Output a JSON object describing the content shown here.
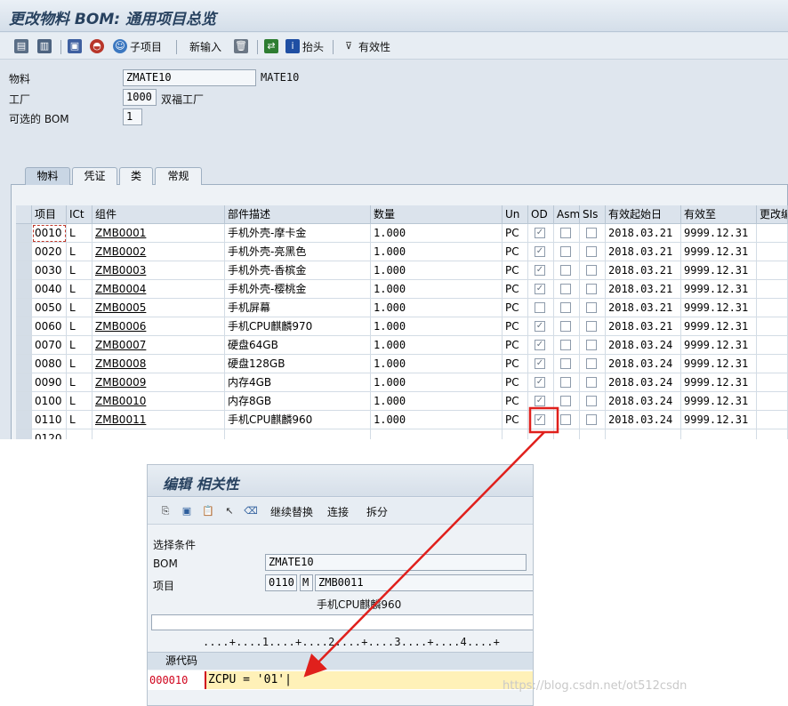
{
  "title": "更改物料 BOM: 通用项目总览",
  "toolbar": {
    "sub_item_label": "子项目",
    "new_entry_label": "新输入",
    "header_label": "抬头",
    "validity_label": "有效性"
  },
  "header_fields": {
    "material_label": "物料",
    "material_value": "ZMATE10",
    "material_desc": "MATE10",
    "plant_label": "工厂",
    "plant_value": "1000",
    "plant_desc": "双福工厂",
    "alt_bom_label": "可选的 BOM",
    "alt_bom_value": "1"
  },
  "tabs": [
    "物料",
    "凭证",
    "类",
    "常规"
  ],
  "table": {
    "columns": [
      "项目",
      "ICt",
      "组件",
      "部件描述",
      "数量",
      "Un",
      "OD",
      "Asm",
      "SIs",
      "有效起始日",
      "有效至",
      "更改编"
    ],
    "rows": [
      {
        "item": "0010",
        "ict": "L",
        "component": "ZMB0001",
        "desc": "手机外壳-摩卡金",
        "qty": "1.000",
        "un": "PC",
        "od": true,
        "valid_from": "2018.03.21",
        "valid_to": "9999.12.31"
      },
      {
        "item": "0020",
        "ict": "L",
        "component": "ZMB0002",
        "desc": "手机外壳-亮黑色",
        "qty": "1.000",
        "un": "PC",
        "od": true,
        "valid_from": "2018.03.21",
        "valid_to": "9999.12.31"
      },
      {
        "item": "0030",
        "ict": "L",
        "component": "ZMB0003",
        "desc": "手机外壳-香槟金",
        "qty": "1.000",
        "un": "PC",
        "od": true,
        "valid_from": "2018.03.21",
        "valid_to": "9999.12.31"
      },
      {
        "item": "0040",
        "ict": "L",
        "component": "ZMB0004",
        "desc": "手机外壳-樱桃金",
        "qty": "1.000",
        "un": "PC",
        "od": true,
        "valid_from": "2018.03.21",
        "valid_to": "9999.12.31"
      },
      {
        "item": "0050",
        "ict": "L",
        "component": "ZMB0005",
        "desc": "手机屏幕",
        "qty": "1.000",
        "un": "PC",
        "od": false,
        "valid_from": "2018.03.21",
        "valid_to": "9999.12.31"
      },
      {
        "item": "0060",
        "ict": "L",
        "component": "ZMB0006",
        "desc": "手机CPU麒麟970",
        "qty": "1.000",
        "un": "PC",
        "od": true,
        "valid_from": "2018.03.21",
        "valid_to": "9999.12.31"
      },
      {
        "item": "0070",
        "ict": "L",
        "component": "ZMB0007",
        "desc": "硬盘64GB",
        "qty": "1.000",
        "un": "PC",
        "od": true,
        "valid_from": "2018.03.24",
        "valid_to": "9999.12.31"
      },
      {
        "item": "0080",
        "ict": "L",
        "component": "ZMB0008",
        "desc": "硬盘128GB",
        "qty": "1.000",
        "un": "PC",
        "od": true,
        "valid_from": "2018.03.24",
        "valid_to": "9999.12.31"
      },
      {
        "item": "0090",
        "ict": "L",
        "component": "ZMB0009",
        "desc": "内存4GB",
        "qty": "1.000",
        "un": "PC",
        "od": true,
        "valid_from": "2018.03.24",
        "valid_to": "9999.12.31"
      },
      {
        "item": "0100",
        "ict": "L",
        "component": "ZMB0010",
        "desc": "内存8GB",
        "qty": "1.000",
        "un": "PC",
        "od": true,
        "valid_from": "2018.03.24",
        "valid_to": "9999.12.31"
      },
      {
        "item": "0110",
        "ict": "L",
        "component": "ZMB0011",
        "desc": "手机CPU麒麟960",
        "qty": "1.000",
        "un": "PC",
        "od": true,
        "valid_from": "2018.03.24",
        "valid_to": "9999.12.31"
      },
      {
        "item": "0120",
        "ict": "",
        "component": "",
        "desc": "",
        "qty": "",
        "un": "",
        "od": false,
        "valid_from": "",
        "valid_to": ""
      }
    ]
  },
  "popup": {
    "title": "编辑 相关性",
    "toolbar": {
      "continue_replace_label": "继续替换",
      "connect_label": "连接",
      "split_label": "拆分"
    },
    "selection_label": "选择条件",
    "bom_label": "BOM",
    "bom_value": "ZMATE10",
    "item_label": "项目",
    "item_value": "0110",
    "item_type": "M",
    "component_value": "ZMB0011",
    "component_desc": "手机CPU麒麟960",
    "ruler": "....+....1....+....2....+....3....+....4....+",
    "source_header": "源代码",
    "line_number": "000010",
    "source_code": "ZCPU = '01'|"
  },
  "watermark": "https://blog.csdn.net/ot512csdn",
  "colors": {
    "annotation_red": "#e0201c",
    "title_text": "#27415f"
  }
}
